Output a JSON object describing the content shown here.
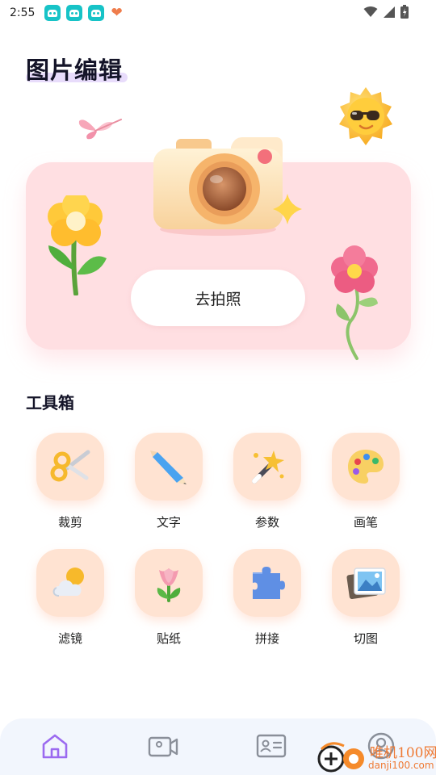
{
  "status_bar": {
    "time": "2:55"
  },
  "page": {
    "title": "图片编辑"
  },
  "hero": {
    "camera_button_label": "去拍照"
  },
  "toolbox": {
    "title": "工具箱",
    "tools": [
      {
        "label": "裁剪",
        "icon": "scissors-icon"
      },
      {
        "label": "文字",
        "icon": "pencil-icon"
      },
      {
        "label": "参数",
        "icon": "magic-wand-icon"
      },
      {
        "label": "画笔",
        "icon": "palette-icon"
      },
      {
        "label": "滤镜",
        "icon": "weather-icon"
      },
      {
        "label": "贴纸",
        "icon": "flower-icon"
      },
      {
        "label": "拼接",
        "icon": "puzzle-icon"
      },
      {
        "label": "切图",
        "icon": "photos-icon"
      }
    ]
  },
  "bottom_nav": {
    "items": [
      "home-icon",
      "video-icon",
      "id-card-icon",
      "profile-icon"
    ],
    "active": "home-icon"
  },
  "watermark": {
    "text": "唯机100网",
    "domain": "danji100.com"
  },
  "colors": {
    "accent": "#9b6af0",
    "hero_bg": "#ffdfe2",
    "tile_bg": "#ffe3d2",
    "nav_bg": "#f2f6fd"
  }
}
